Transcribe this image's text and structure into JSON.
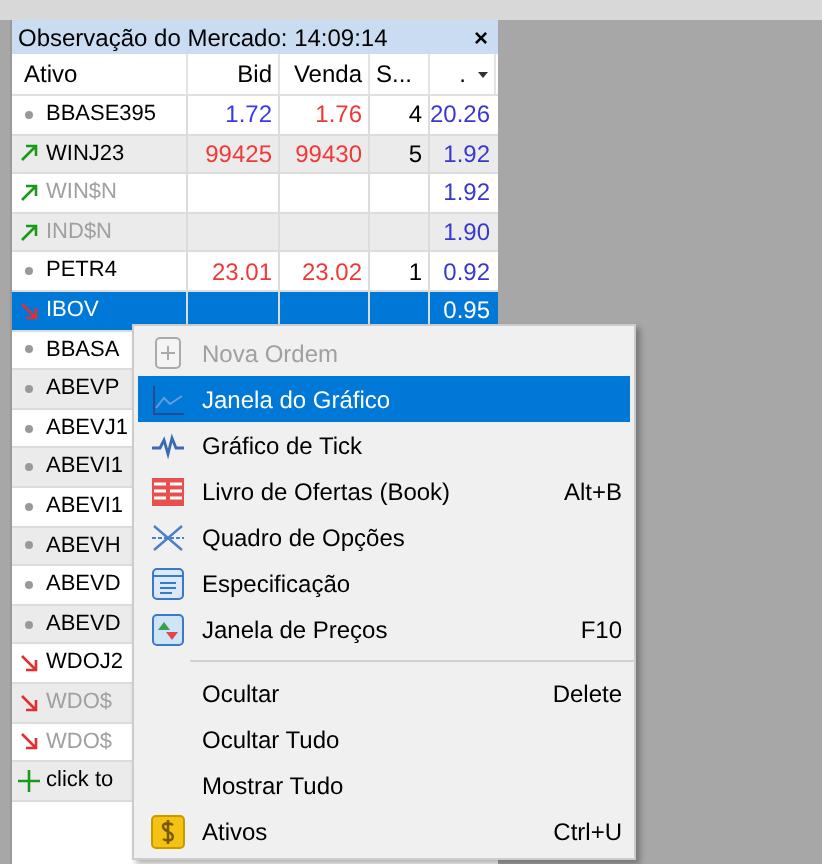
{
  "panel": {
    "title": "Observação do Mercado: 14:09:14",
    "close": "×"
  },
  "columns": [
    "Ativo",
    "Bid",
    "Venda",
    "S...",
    "."
  ],
  "rows": [
    {
      "kind": "dot",
      "symbol": "BBASE395",
      "disabled": false,
      "selected": false,
      "bid": {
        "value": "1.72",
        "color": "#3838f0"
      },
      "ask": {
        "value": "1.76",
        "color": "#f03838"
      },
      "spread": "4",
      "last": "20.26"
    },
    {
      "kind": "up",
      "symbol": "WINJ23",
      "disabled": false,
      "selected": false,
      "bid": {
        "value": "99425",
        "color": "#f03838"
      },
      "ask": {
        "value": "99430",
        "color": "#f03838"
      },
      "spread": "5",
      "last": "1.92"
    },
    {
      "kind": "up",
      "symbol": "WIN$N",
      "disabled": true,
      "selected": false,
      "last": "1.92"
    },
    {
      "kind": "up",
      "symbol": "IND$N",
      "disabled": true,
      "selected": false,
      "last": "1.90"
    },
    {
      "kind": "dot",
      "symbol": "PETR4",
      "disabled": false,
      "selected": false,
      "bid": {
        "value": "23.01",
        "color": "#f03838"
      },
      "ask": {
        "value": "23.02",
        "color": "#f03838"
      },
      "spread": "1",
      "last": "0.92"
    },
    {
      "kind": "down",
      "symbol": "IBOV",
      "disabled": false,
      "selected": true,
      "last": "0.95"
    },
    {
      "kind": "dot",
      "symbol": "BBASA",
      "disabled": false,
      "selected": false
    },
    {
      "kind": "dot",
      "symbol": "ABEVP",
      "disabled": false,
      "selected": false
    },
    {
      "kind": "dot",
      "symbol": "ABEVJ1",
      "disabled": false,
      "selected": false
    },
    {
      "kind": "dot",
      "symbol": "ABEVI1",
      "disabled": false,
      "selected": false
    },
    {
      "kind": "dot",
      "symbol": "ABEVI1",
      "disabled": false,
      "selected": false
    },
    {
      "kind": "dot",
      "symbol": "ABEVH",
      "disabled": false,
      "selected": false
    },
    {
      "kind": "dot",
      "symbol": "ABEVD",
      "disabled": false,
      "selected": false
    },
    {
      "kind": "dot",
      "symbol": "ABEVD",
      "disabled": false,
      "selected": false
    },
    {
      "kind": "down",
      "symbol": "WDOJ2",
      "disabled": false,
      "selected": false
    },
    {
      "kind": "down",
      "symbol": "WDO$",
      "disabled": true,
      "selected": false
    },
    {
      "kind": "down",
      "symbol": "WDO$",
      "disabled": true,
      "selected": false
    },
    {
      "kind": "add",
      "symbol": "click to",
      "disabled": false,
      "selected": false
    }
  ],
  "menu": [
    {
      "kind": "item",
      "label": "Nova Ordem",
      "disabled": true,
      "selected": false
    },
    {
      "kind": "item",
      "label": "Janela do Gráfico",
      "disabled": false,
      "selected": true
    },
    {
      "kind": "item",
      "label": "Gráfico de Tick",
      "disabled": false,
      "selected": false
    },
    {
      "kind": "item",
      "label": "Livro de Ofertas (Book)",
      "shortcut": "Alt+B",
      "disabled": false,
      "selected": false
    },
    {
      "kind": "item",
      "label": "Quadro de Opções",
      "disabled": false,
      "selected": false
    },
    {
      "kind": "item",
      "label": "Especificação",
      "disabled": false,
      "selected": false
    },
    {
      "kind": "item",
      "label": "Janela de Preços",
      "shortcut": "F10",
      "disabled": false,
      "selected": false
    },
    {
      "kind": "separator"
    },
    {
      "kind": "item",
      "label": "Ocultar",
      "shortcut": "Delete",
      "disabled": false,
      "selected": false
    },
    {
      "kind": "item",
      "label": "Ocultar Tudo",
      "disabled": false,
      "selected": false
    },
    {
      "kind": "item",
      "label": "Mostrar Tudo",
      "disabled": false,
      "selected": false
    },
    {
      "kind": "item",
      "label": "Ativos",
      "shortcut": "Ctrl+U",
      "disabled": false,
      "selected": false
    }
  ]
}
